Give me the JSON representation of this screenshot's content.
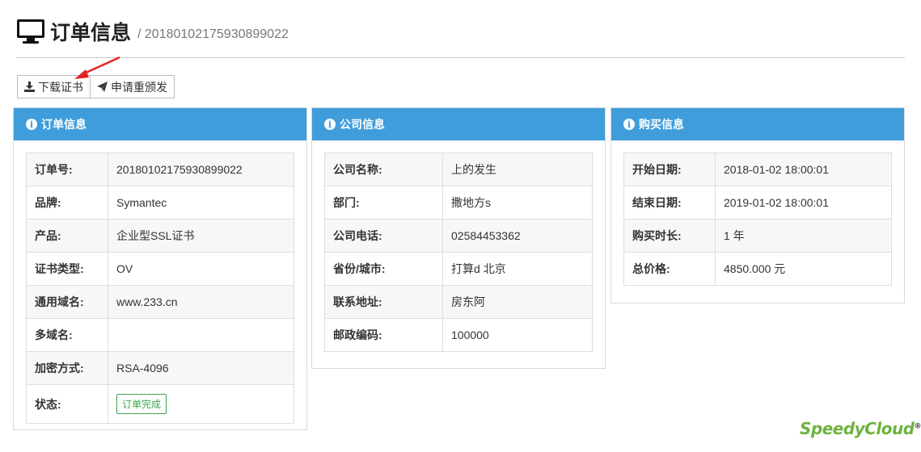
{
  "header": {
    "title": "订单信息",
    "subtitle": "/ 20180102175930899022"
  },
  "toolbar": {
    "download_label": "下载证书",
    "reissue_label": "申请重颁发"
  },
  "order_panel": {
    "title": "订单信息",
    "rows": [
      {
        "key": "订单号:",
        "value": "20180102175930899022"
      },
      {
        "key": "品牌:",
        "value": "Symantec"
      },
      {
        "key": "产品:",
        "value": "企业型SSL证书"
      },
      {
        "key": "证书类型:",
        "value": "OV"
      },
      {
        "key": "通用域名:",
        "value": "www.233.cn"
      },
      {
        "key": "多域名:",
        "value": ""
      },
      {
        "key": "加密方式:",
        "value": "RSA-4096"
      },
      {
        "key": "状态:",
        "value": "订单完成"
      }
    ]
  },
  "company_panel": {
    "title": "公司信息",
    "rows": [
      {
        "key": "公司名称:",
        "value": "上的发生"
      },
      {
        "key": "部门:",
        "value": "撒地方s"
      },
      {
        "key": "公司电话:",
        "value": "02584453362"
      },
      {
        "key": "省份/城市:",
        "value": "打算d 北京"
      },
      {
        "key": "联系地址:",
        "value": "房东阿"
      },
      {
        "key": "邮政编码:",
        "value": "100000"
      }
    ]
  },
  "purchase_panel": {
    "title": "购买信息",
    "rows": [
      {
        "key": "开始日期:",
        "value": "2018-01-02 18:00:01"
      },
      {
        "key": "结束日期:",
        "value": "2019-01-02 18:00:01"
      },
      {
        "key": "购买时长:",
        "value": "1 年"
      },
      {
        "key": "总价格:",
        "value": "4850.000 元"
      }
    ]
  },
  "brand": {
    "name": "SpeedyCloud",
    "mark": "®"
  },
  "icons": {
    "title": "monitor-icon",
    "download": "download-icon",
    "reissue": "paper-plane-icon",
    "panel": "info-circle-icon"
  },
  "colors": {
    "panel_heading": "#3f9ddb",
    "status_badge": "#3fa34d",
    "brand": "#6db33f",
    "annotation_arrow": "#e02424"
  }
}
